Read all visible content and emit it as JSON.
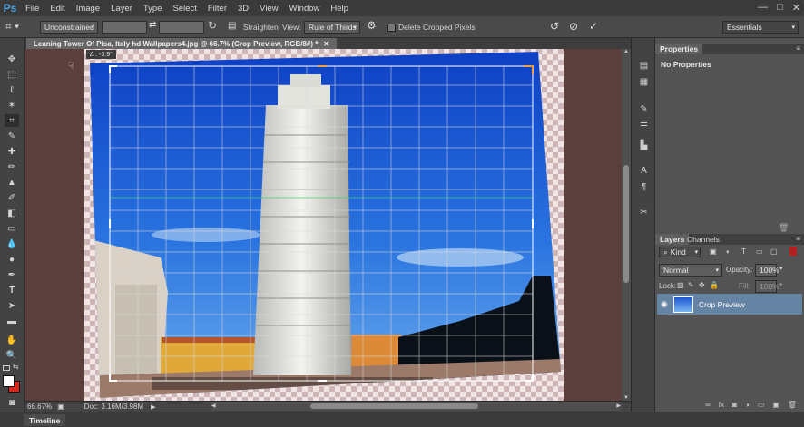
{
  "app": {
    "logo": "Ps"
  },
  "menu": [
    "File",
    "Edit",
    "Image",
    "Layer",
    "Type",
    "Select",
    "Filter",
    "3D",
    "View",
    "Window",
    "Help"
  ],
  "window_controls": {
    "minimize": "—",
    "maximize": "□",
    "close": "✕"
  },
  "options": {
    "ratio_value": "Unconstrained",
    "straighten_label": "Straighten",
    "view_label": "View:",
    "view_value": "Rule of Thirds",
    "delete_cropped_label": "Delete Cropped Pixels",
    "delete_cropped_checked": false,
    "workspace_value": "Essentials"
  },
  "document": {
    "tab_title": "Leaning Tower Of Pisa, Italy hd Wallpapers4.jpg @ 66.7% (Crop Preview, RGB/8#) *",
    "rotation_readout": "Δ : -3.9°",
    "zoom": "66.67%",
    "doc_size": "Doc: 3.16M/3.98M"
  },
  "panels": {
    "properties_tab": "Properties",
    "properties_text": "No Properties",
    "layers_tab": "Layers",
    "channels_tab": "Channels",
    "filter_kind": "Kind",
    "blend_mode": "Normal",
    "opacity_label": "Opacity:",
    "opacity_value": "100%",
    "lock_label": "Lock:",
    "fill_label": "Fill:",
    "fill_value": "100%",
    "layer_name": "Crop Preview"
  },
  "timeline_label": "Timeline",
  "colors": {
    "foreground": "#ffffff",
    "background": "#d8261c",
    "accent": "#6583a3"
  }
}
